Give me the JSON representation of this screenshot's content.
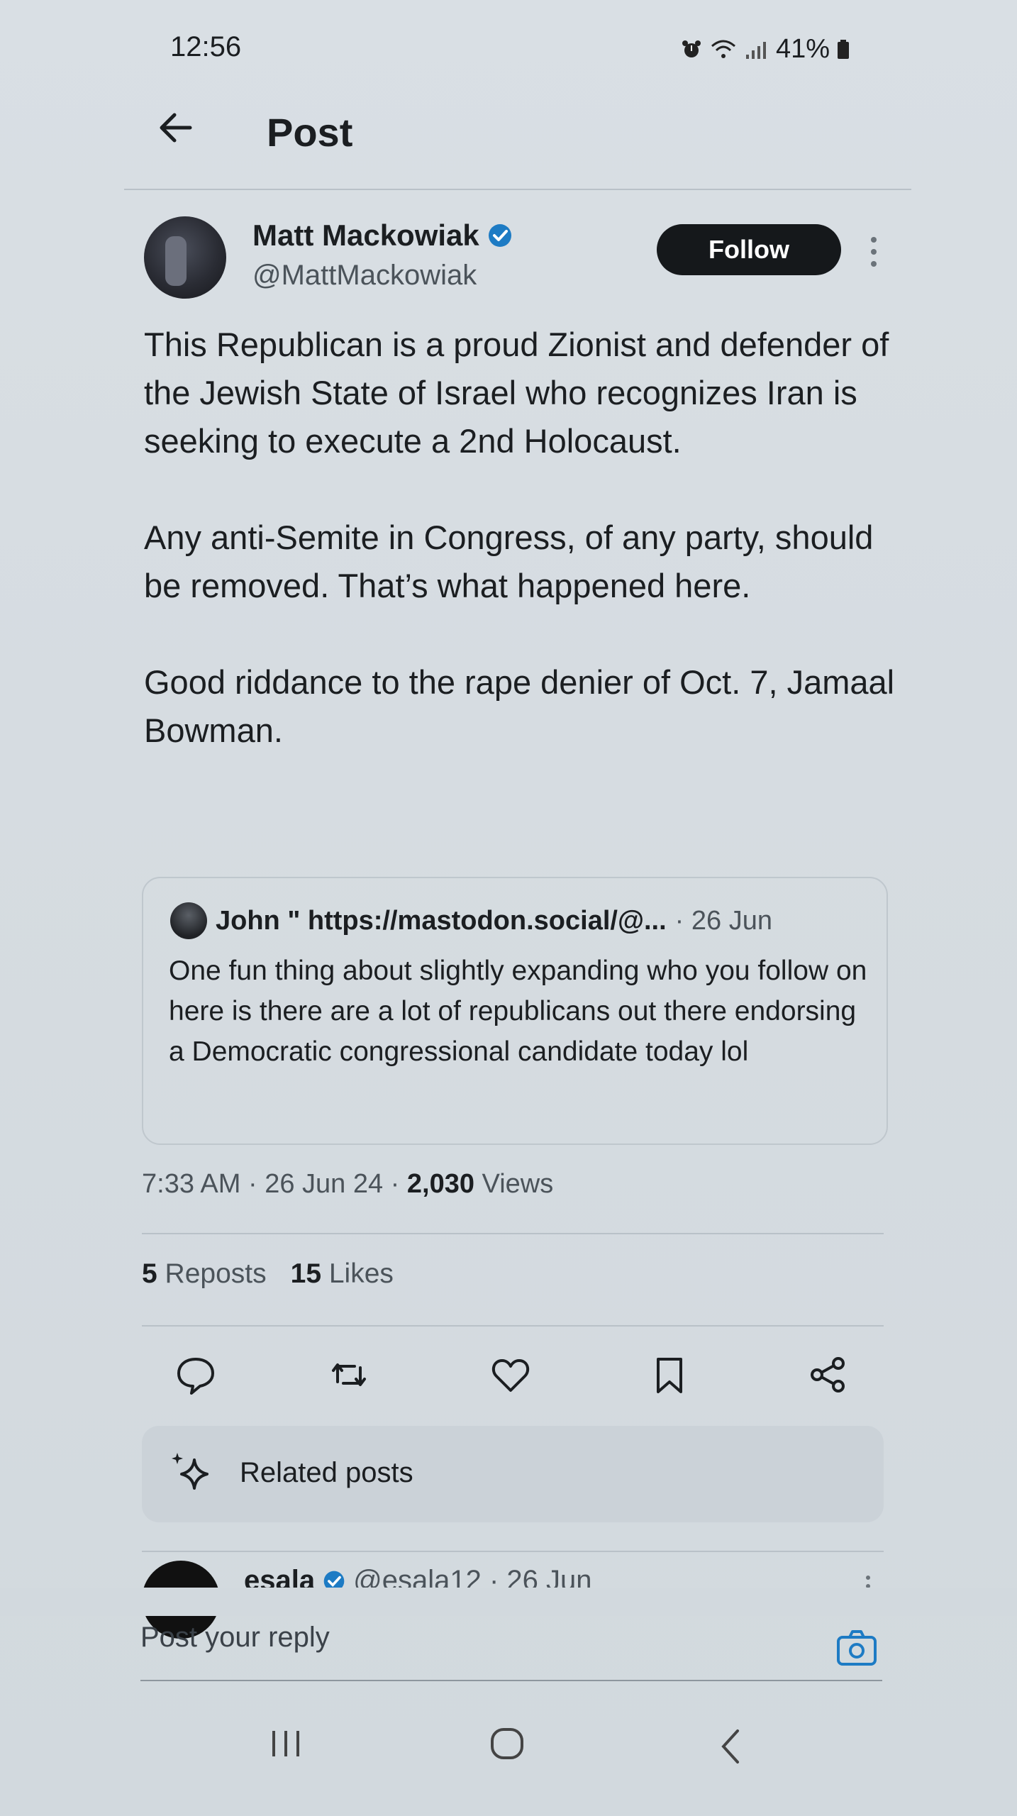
{
  "status_bar": {
    "time": "12:56",
    "battery": "41%",
    "icons": [
      "alarm-icon",
      "wifi-icon",
      "signal-icon",
      "battery-icon"
    ]
  },
  "header": {
    "title": "Post",
    "back_icon": "arrow-left-icon"
  },
  "author": {
    "name": "Matt Mackowiak",
    "handle": "@MattMackowiak",
    "verified": true,
    "follow_label": "Follow"
  },
  "post": {
    "paragraphs": [
      "This Republican is a proud Zionist and defender of the Jewish State of Israel who recognizes Iran is seeking to execute a 2nd Holocaust.",
      "Any anti-Semite in Congress, of any party, should be removed. That’s what happened here.",
      "Good riddance to the rape denier of Oct. 7, Jamaal Bowman."
    ]
  },
  "quote": {
    "name": "John \" https://mastodon.social/@...",
    "date": "· 26 Jun",
    "text": "One fun thing about slightly expanding who you follow on here is there are a lot of republicans out there endorsing a Democratic congressional candidate today lol"
  },
  "meta": {
    "time_date": "7:33 AM · 26 Jun 24 · ",
    "views_count": "2,030",
    "views_label": " Views"
  },
  "engagement": {
    "reposts_count": "5",
    "reposts_label": "Reposts",
    "likes_count": "15",
    "likes_label": "Likes"
  },
  "actions": [
    "reply-icon",
    "repost-icon",
    "like-icon",
    "bookmark-icon",
    "share-icon"
  ],
  "related": {
    "label": "Related posts"
  },
  "next_post": {
    "name": "esala",
    "handle": "@esala12 · 26 Jun"
  },
  "reply": {
    "placeholder": "Post your reply"
  },
  "nav_bar": [
    "recent-apps-icon",
    "home-icon",
    "back-icon"
  ],
  "colors": {
    "accent_blue": "#1d7bc4",
    "follow_button": "#15181b",
    "text": "#1b1e21",
    "muted": "#4b535a"
  }
}
